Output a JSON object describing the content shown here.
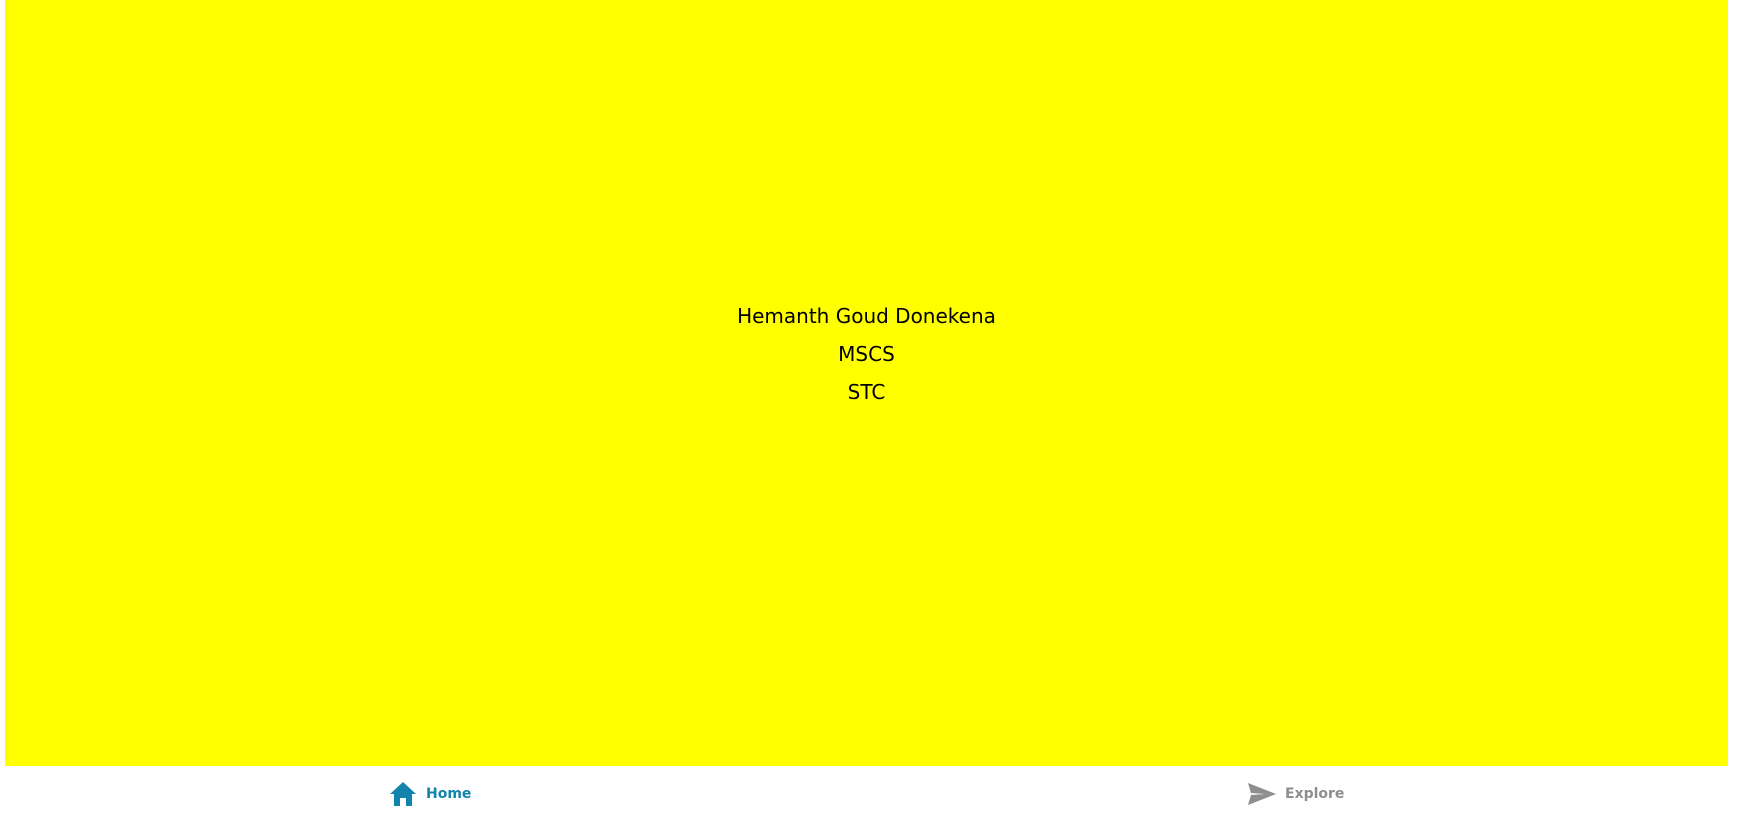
{
  "profile": {
    "name": "Hemanth Goud Donekena",
    "program": "MSCS",
    "school": "STC"
  },
  "tabs": [
    {
      "label": "Home",
      "icon": "home-icon",
      "active": true,
      "color": "#1283ad"
    },
    {
      "label": "Explore",
      "icon": "send-icon",
      "active": false,
      "color": "#8e8e8e"
    }
  ],
  "colors": {
    "content_background": "#ffff00",
    "tabbar_background": "#ffffff",
    "text": "#000000"
  }
}
